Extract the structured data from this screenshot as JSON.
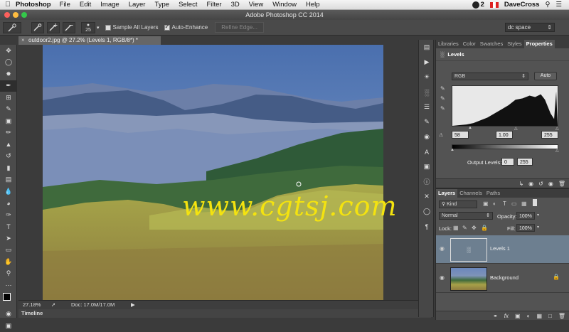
{
  "menubar": {
    "apple": "",
    "app": "Photoshop",
    "items": [
      "File",
      "Edit",
      "Image",
      "Layer",
      "Type",
      "Select",
      "Filter",
      "3D",
      "View",
      "Window",
      "Help"
    ],
    "cc_count": "2",
    "user": "DaveCross"
  },
  "window": {
    "title": "Adobe Photoshop CC 2014"
  },
  "options": {
    "brush_size": "25",
    "sample_all_layers": "Sample All Layers",
    "auto_enhance": "Auto-Enhance",
    "refine_edge": "Refine Edge...",
    "workspace": "dc space"
  },
  "document": {
    "tab_title": "outdoor2.jpg @ 27.2% (Levels 1, RGB/8*) *",
    "zoom": "27.18%",
    "doc_size": "Doc: 17.0M/17.0M",
    "timeline": "Timeline",
    "watermark": "www.cgtsj.com"
  },
  "properties": {
    "tabs": [
      "Libraries",
      "Color",
      "Swatches",
      "Styles",
      "Properties"
    ],
    "active_tab": "Properties",
    "adjustment": "Levels",
    "channel": "RGB",
    "auto": "Auto",
    "input_black": "58",
    "input_gamma": "1.00",
    "input_white": "255",
    "output_label": "Output Levels:",
    "output_black": "0",
    "output_white": "255"
  },
  "layers": {
    "tabs": [
      "Layers",
      "Channels",
      "Paths"
    ],
    "active_tab": "Layers",
    "kind": "Kind",
    "blend_mode": "Normal",
    "opacity_label": "Opacity:",
    "opacity": "100%",
    "lock_label": "Lock:",
    "fill_label": "Fill:",
    "fill": "100%",
    "items": [
      {
        "name": "Levels 1"
      },
      {
        "name": "Background"
      }
    ]
  }
}
